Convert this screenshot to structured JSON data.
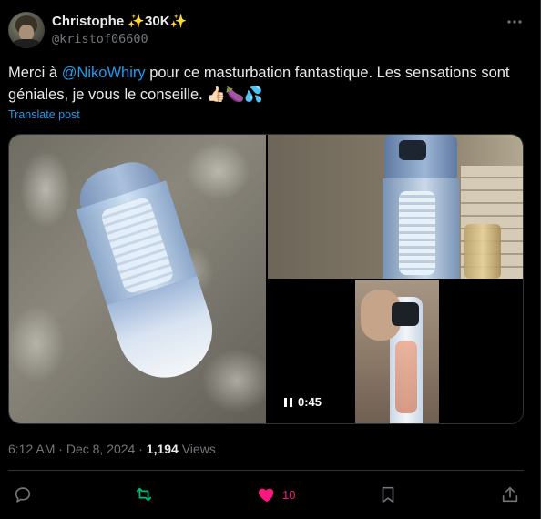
{
  "author": {
    "name": "Christophe ✨30K✨",
    "handle": "@kristof06600"
  },
  "tweet": {
    "text_before": "Merci à ",
    "mention": "@NikoWhiry",
    "text_after": "  pour ce masturbation fantastique. Les sensations sont géniales, je vous le conseille. 👍🏻🍆💦",
    "translate_label": "Translate post"
  },
  "media": {
    "video_time": "0:45"
  },
  "meta": {
    "time": "6:12 AM",
    "separator": " · ",
    "date": "Dec 8, 2024",
    "views_count": "1,194",
    "views_label": " Views"
  },
  "actions": {
    "likes_count": "10"
  },
  "colors": {
    "accent": "#1d9bf0",
    "like": "#f91880",
    "repost": "#00ba7c",
    "muted": "#71767b",
    "background": "#000000"
  },
  "icons": [
    "more-icon",
    "reply-icon",
    "repost-icon",
    "like-icon",
    "bookmark-icon",
    "share-icon",
    "pause-icon"
  ]
}
